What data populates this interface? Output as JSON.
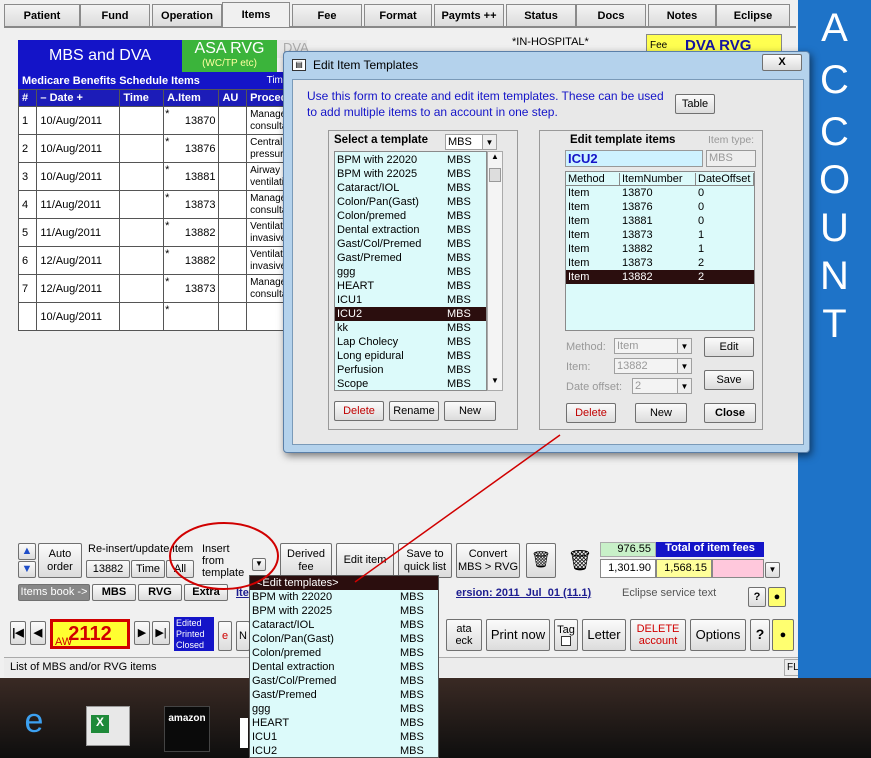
{
  "tabs": [
    {
      "label": "Patient"
    },
    {
      "label": "Fund"
    },
    {
      "label": "Operation"
    },
    {
      "label": "Items"
    },
    {
      "label": "Fee"
    },
    {
      "label": "Format"
    },
    {
      "label": "Paymts ++"
    },
    {
      "label": "Status"
    },
    {
      "label": "Docs"
    },
    {
      "label": "Notes"
    },
    {
      "label": "Eclipse"
    }
  ],
  "header": {
    "mbs_dva": "MBS and DVA",
    "asa_rvg": "ASA RVG",
    "asa_sub": "(WC/TP etc)",
    "dva_tab": "DVA",
    "in_hospital": "*IN-HOSPITAL*",
    "fee_label": "Fee",
    "fee_value": "DVA RVG"
  },
  "sidebar": {
    "letters": [
      "A",
      "C",
      "C",
      "O",
      "U",
      "N",
      "T"
    ]
  },
  "items_table": {
    "title": "Medicare Benefits Schedule Items",
    "time_units": "Time Units",
    "columns": [
      "#",
      "–  Date  +",
      "Time",
      "A.Item",
      "AU",
      "Procedure"
    ],
    "rows": [
      {
        "n": "1",
        "date": "10/Aug/2011",
        "item": "13870",
        "proc": [
          "Manageme",
          "consultant p"
        ]
      },
      {
        "n": "2",
        "date": "10/Aug/2011",
        "item": "13876",
        "proc": [
          "Central ven",
          "pressure or"
        ]
      },
      {
        "n": "3",
        "date": "10/Aug/2011",
        "item": "13881",
        "proc": [
          "Airway acce",
          "ventilation,"
        ]
      },
      {
        "n": "4",
        "date": "11/Aug/2011",
        "item": "13873",
        "proc": [
          "Manageme",
          "consultant p"
        ]
      },
      {
        "n": "5",
        "date": "11/Aug/2011",
        "item": "13882",
        "proc": [
          "Ventilatory s",
          "invasive me"
        ]
      },
      {
        "n": "6",
        "date": "12/Aug/2011",
        "item": "13882",
        "proc": [
          "Ventilatory s",
          "invasive me"
        ]
      },
      {
        "n": "7",
        "date": "12/Aug/2011",
        "item": "13873",
        "proc": [
          "Manageme",
          "consultant p"
        ]
      },
      {
        "n": "",
        "date": "10/Aug/2011",
        "item": "",
        "proc": [
          "",
          ""
        ]
      }
    ]
  },
  "dialog": {
    "title": "Edit Item Templates",
    "close": "X",
    "intro": "Use this form to create and edit item templates. These can be used to add multiple items to an account in one step.",
    "table_btn": "Table",
    "select_label": "Select a template",
    "select_combo": "MBS",
    "templates": [
      {
        "name": "BPM with 22020",
        "type": "MBS"
      },
      {
        "name": "BPM with 22025",
        "type": "MBS"
      },
      {
        "name": "Cataract/IOL",
        "type": "MBS"
      },
      {
        "name": "Colon/Pan(Gast)",
        "type": "MBS"
      },
      {
        "name": "Colon/premed",
        "type": "MBS"
      },
      {
        "name": "Dental extraction",
        "type": "MBS"
      },
      {
        "name": "Gast/Col/Premed",
        "type": "MBS"
      },
      {
        "name": "Gast/Premed",
        "type": "MBS"
      },
      {
        "name": "ggg",
        "type": "MBS"
      },
      {
        "name": "HEART",
        "type": "MBS"
      },
      {
        "name": "ICU1",
        "type": "MBS"
      },
      {
        "name": "ICU2",
        "type": "MBS"
      },
      {
        "name": "kk",
        "type": "MBS"
      },
      {
        "name": "Lap Cholecy",
        "type": "MBS"
      },
      {
        "name": "Long epidural",
        "type": "MBS"
      },
      {
        "name": "Perfusion",
        "type": "MBS"
      },
      {
        "name": "Scope",
        "type": "MBS"
      }
    ],
    "selected_template": "ICU2",
    "left_buttons": {
      "delete": "Delete",
      "rename": "Rename",
      "new": "New"
    },
    "edit_label": "Edit template items",
    "item_type_label": "Item type:",
    "template_name": "ICU2",
    "item_type_value": "MBS",
    "items_columns": [
      "Method",
      "ItemNumber",
      "DateOffset"
    ],
    "items": [
      {
        "method": "Item",
        "number": "13870",
        "offset": "0"
      },
      {
        "method": "Item",
        "number": "13876",
        "offset": "0"
      },
      {
        "method": "Item",
        "number": "13881",
        "offset": "0"
      },
      {
        "method": "Item",
        "number": "13873",
        "offset": "1"
      },
      {
        "method": "Item",
        "number": "13882",
        "offset": "1"
      },
      {
        "method": "Item",
        "number": "13873",
        "offset": "2"
      },
      {
        "method": "Item",
        "number": "13882",
        "offset": "2"
      }
    ],
    "method_label": "Method:",
    "method_value": "Item",
    "item_label": "Item:",
    "item_value": "13882",
    "offset_label": "Date offset:",
    "offset_value": "2",
    "edit_btn": "Edit",
    "save_btn": "Save",
    "right_buttons": {
      "delete": "Delete",
      "new": "New",
      "close": "Close"
    }
  },
  "toolbar": {
    "auto_order": "Auto order",
    "reinsert": "Re-insert/update item",
    "reinsert_item": "13882",
    "time_btn": "Time",
    "all_btn": "All",
    "insert_template": "Insert from template",
    "derived_fee": "Derived fee",
    "edit_item": "Edit item",
    "save_quick": "Save to quick list",
    "convert": "Convert MBS > RVG",
    "fee_top": "976.55",
    "total_label": "Total of item fees",
    "fee_a": "1,301.90",
    "fee_b": "1,568.15"
  },
  "tabs2": {
    "items_book": "Items book ->",
    "mbs": "MBS",
    "rvg": "RVG",
    "extra": "Extra",
    "version": "ersion: 2011_Jul_01 (11.1)",
    "eclipse": "Eclipse service text",
    "item_link": "Ite"
  },
  "nav": {
    "record": "2112",
    "aw": "AW",
    "status": [
      "Edited",
      "Printed",
      "Closed"
    ],
    "data_check": "ata eck",
    "print_now": "Print now",
    "tag": "Tag",
    "letter": "Letter",
    "delete_account": "DELETE account",
    "options": "Options",
    "help": "?"
  },
  "statusbar": {
    "text": "List of MBS and/or RVG items",
    "fltr": "FLTR"
  },
  "dropdown": {
    "header": "<Edit templates>",
    "items": [
      {
        "name": "BPM with 22020",
        "type": "MBS"
      },
      {
        "name": "BPM with 22025",
        "type": "MBS"
      },
      {
        "name": "Cataract/IOL",
        "type": "MBS"
      },
      {
        "name": "Colon/Pan(Gast)",
        "type": "MBS"
      },
      {
        "name": "Colon/premed",
        "type": "MBS"
      },
      {
        "name": "Dental extraction",
        "type": "MBS"
      },
      {
        "name": "Gast/Col/Premed",
        "type": "MBS"
      },
      {
        "name": "Gast/Premed",
        "type": "MBS"
      },
      {
        "name": "ggg",
        "type": "MBS"
      },
      {
        "name": "HEART",
        "type": "MBS"
      },
      {
        "name": "ICU1",
        "type": "MBS"
      },
      {
        "name": "ICU2",
        "type": "MBS"
      }
    ]
  },
  "taskbar": {
    "amazon": "amazon"
  }
}
